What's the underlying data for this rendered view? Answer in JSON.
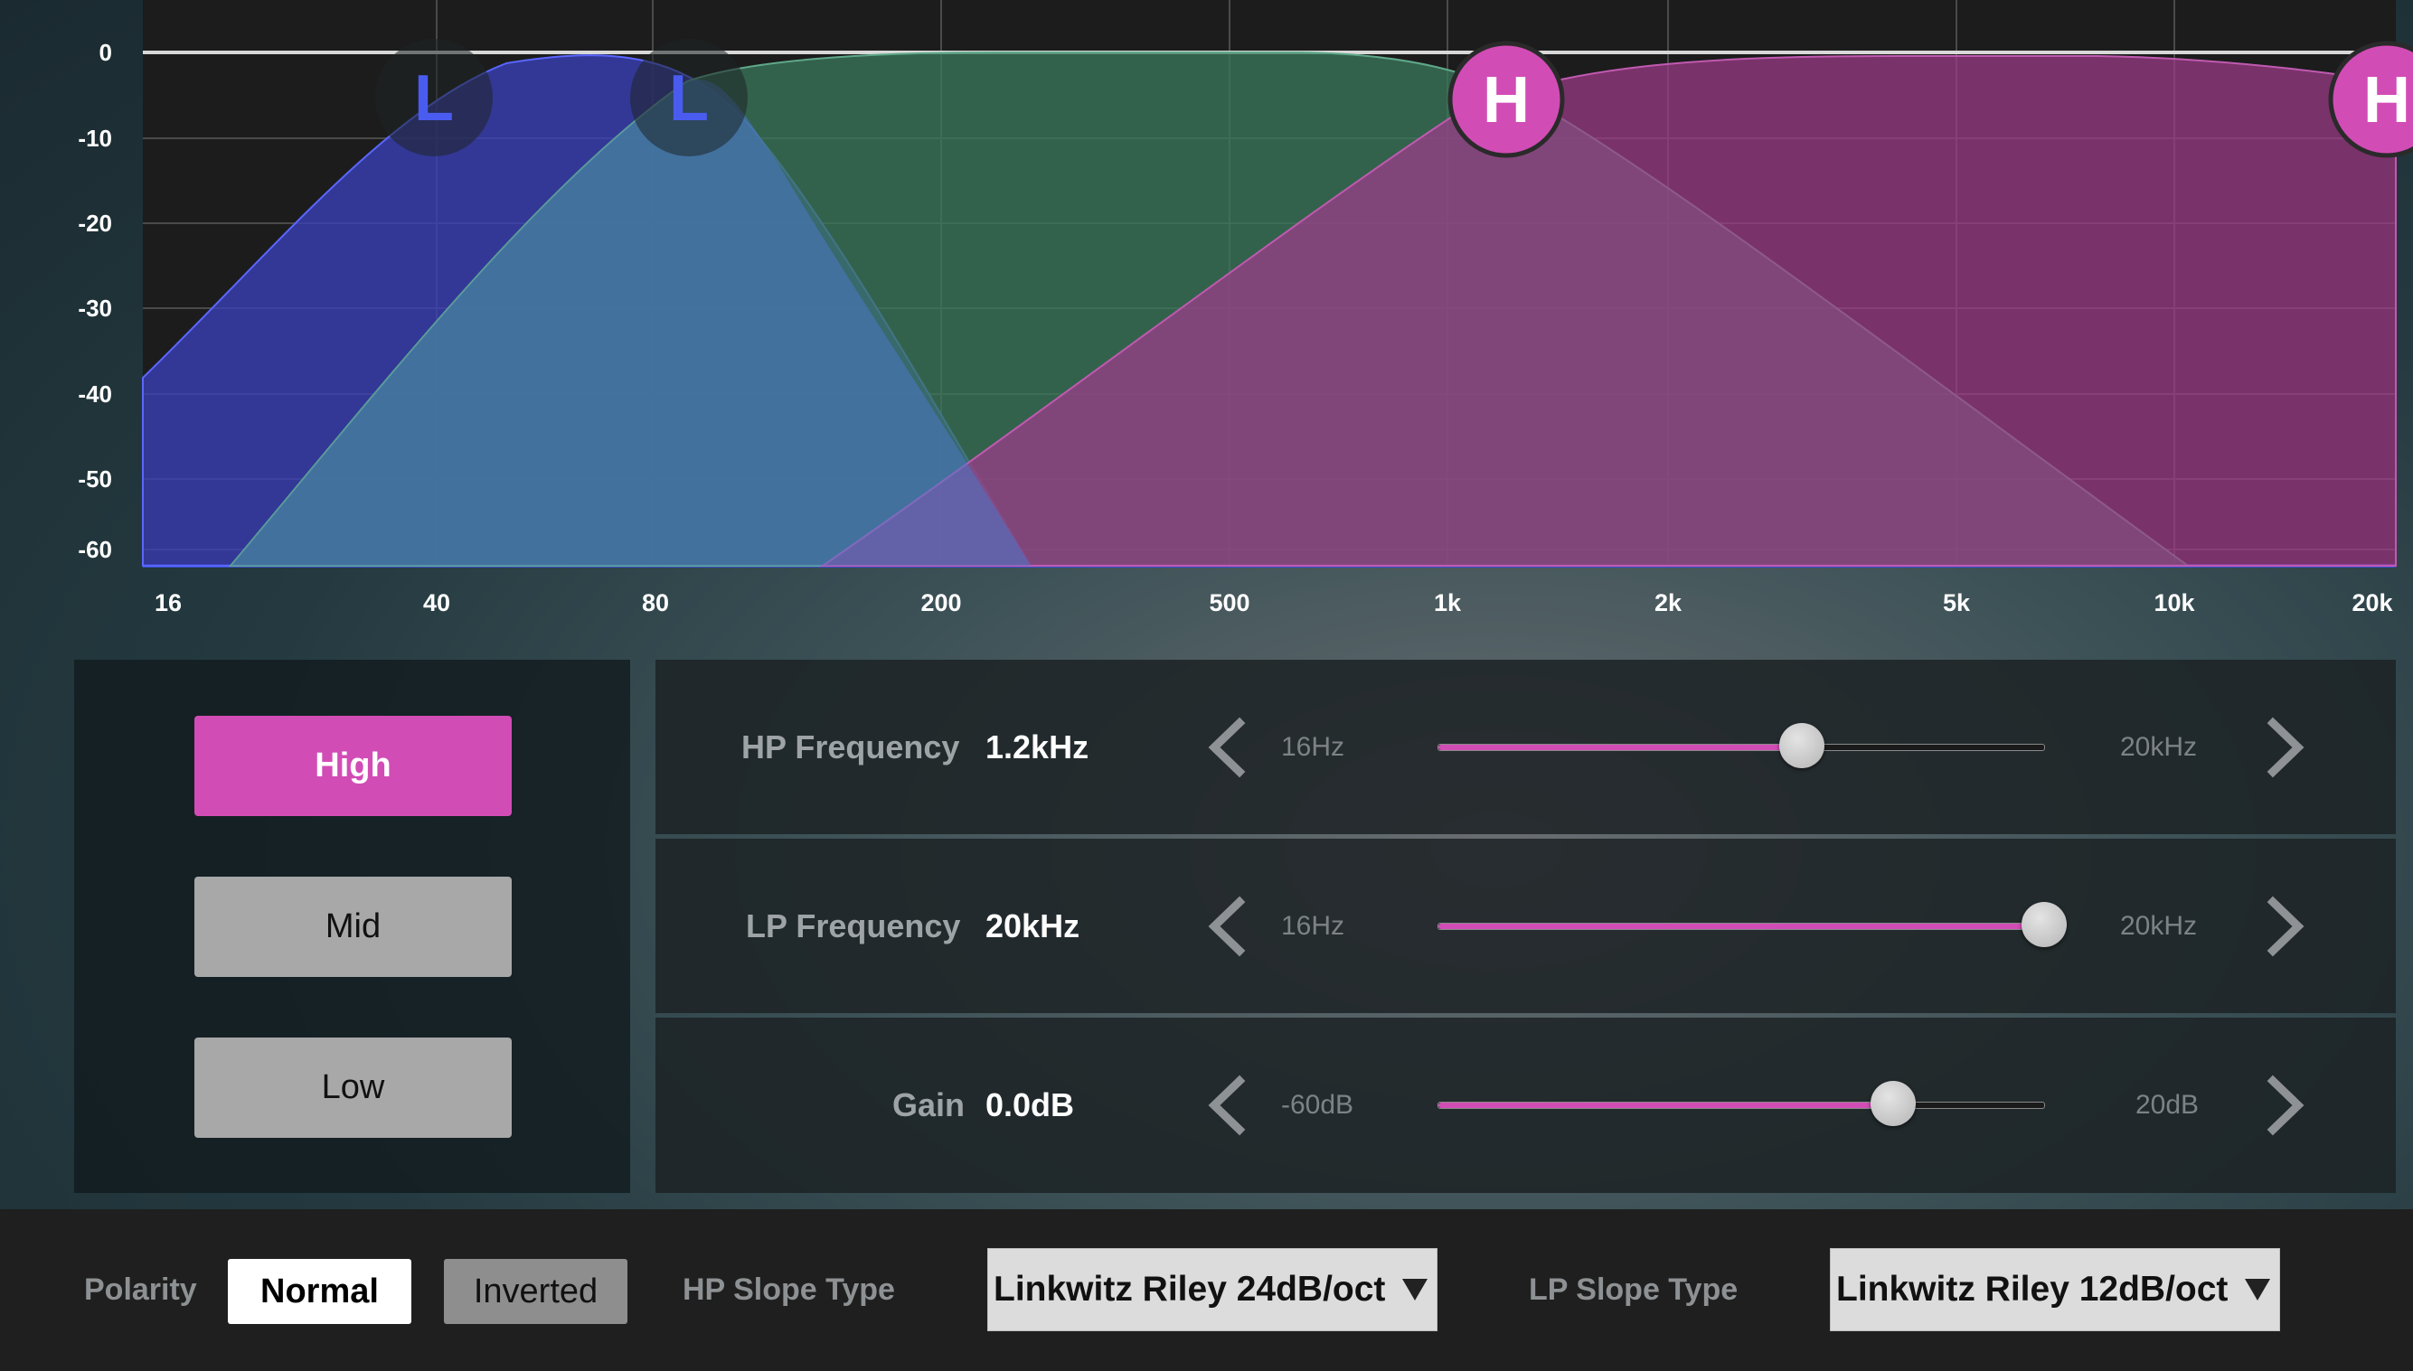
{
  "graph": {
    "y_axis_ticks": [
      "0",
      "-10",
      "-20",
      "-30",
      "-40",
      "-50",
      "-60"
    ],
    "x_axis_ticks": [
      "16",
      "40",
      "80",
      "200",
      "500",
      "1k",
      "2k",
      "5k",
      "10k",
      "20k"
    ],
    "band_colors": {
      "low": "#3a40b8",
      "mid": "#3b7a5c",
      "high": "#a03c8a",
      "accent": "#d24cb6"
    },
    "markers": [
      {
        "label": "L",
        "band": "low",
        "type": "lowpass"
      },
      {
        "label": "L",
        "band": "mid",
        "type": "lowpass"
      },
      {
        "label": "H",
        "band": "mid",
        "type": "highpass"
      },
      {
        "label": "H",
        "band": "high",
        "type": "highpass"
      }
    ]
  },
  "bands": {
    "high_label": "High",
    "mid_label": "Mid",
    "low_label": "Low",
    "selected": "High"
  },
  "controls": {
    "hp": {
      "label": "HP Frequency",
      "value": "1.2kHz",
      "min_label": "16Hz",
      "max_label": "20kHz",
      "level": 0.6
    },
    "lp": {
      "label": "LP Frequency",
      "value": "20kHz",
      "min_label": "16Hz",
      "max_label": "20kHz",
      "level": 1.0
    },
    "gain": {
      "label": "Gain",
      "value": "0.0dB",
      "min_label": "-60dB",
      "max_label": "20dB",
      "level": 0.75
    }
  },
  "bottom": {
    "polarity_label": "Polarity",
    "polarity_normal": "Normal",
    "polarity_inverted": "Inverted",
    "hp_slope_label": "HP Slope Type",
    "hp_slope_value": "Linkwitz Riley 24dB/oct",
    "lp_slope_label": "LP Slope Type",
    "lp_slope_value": "Linkwitz Riley 12dB/oct"
  }
}
